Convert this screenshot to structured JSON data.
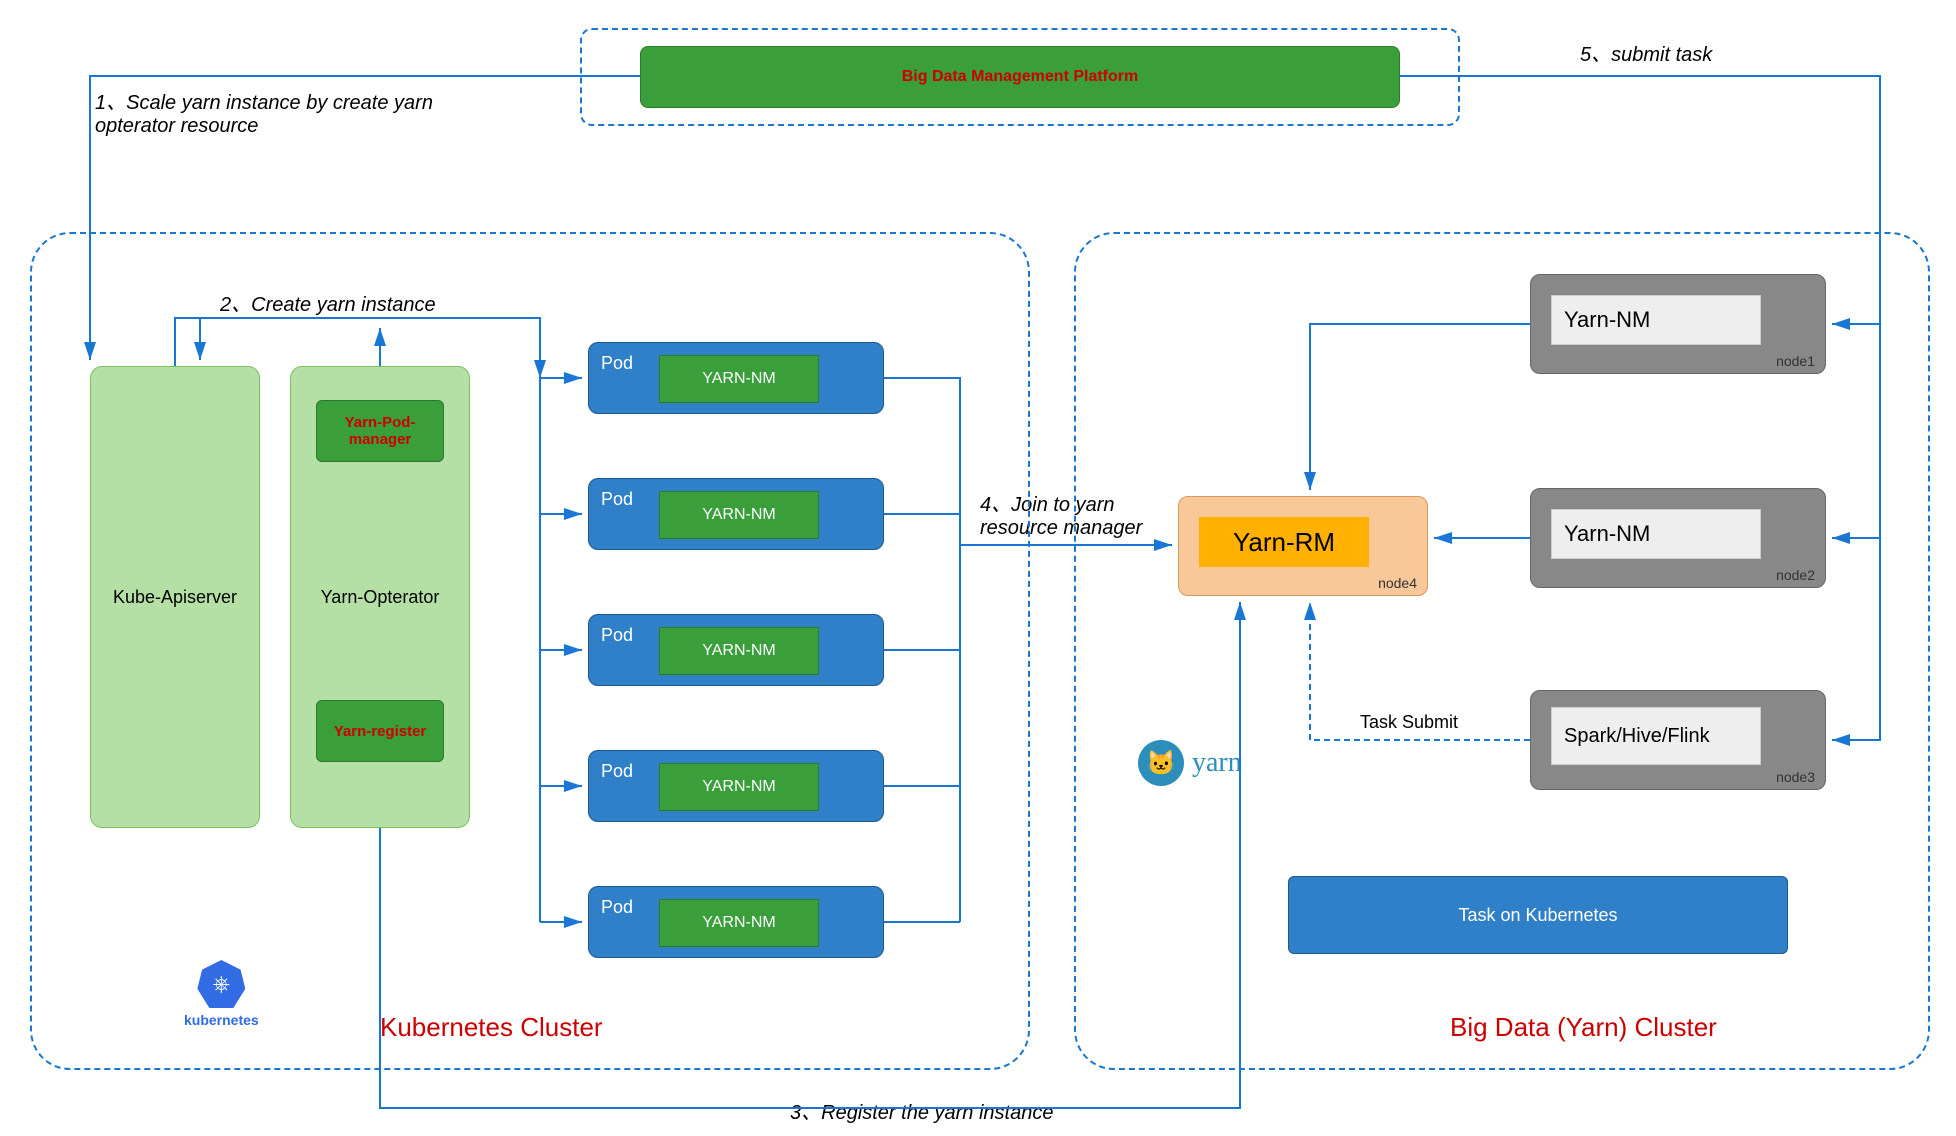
{
  "top": {
    "platform_label": "Big Data Management Platform"
  },
  "steps": {
    "s1": "1、Scale yarn instance by create yarn opterator resource",
    "s2": "2、Create yarn instance",
    "s3": "3、Register the yarn instance",
    "s4": "4、Join to yarn resource manager",
    "s5": "5、submit task"
  },
  "k8s": {
    "title": "Kubernetes Cluster",
    "apiserver": "Kube-Apiserver",
    "operator": "Yarn-Opterator",
    "pod_manager": "Yarn-Pod-manager",
    "register": "Yarn-register",
    "pod_label": "Pod",
    "pod_inner": "YARN-NM",
    "logo_text": "kubernetes"
  },
  "yarn": {
    "title": "Big Data (Yarn) Cluster",
    "rm": "Yarn-RM",
    "rm_node": "node4",
    "nm1": "Yarn-NM",
    "nm1_node": "node1",
    "nm2": "Yarn-NM",
    "nm2_node": "node2",
    "spark": "Spark/Hive/Flink",
    "spark_node": "node3",
    "task_submit": "Task Submit",
    "task_k8s": "Task on Kubernetes",
    "logo_text": "yarn"
  }
}
